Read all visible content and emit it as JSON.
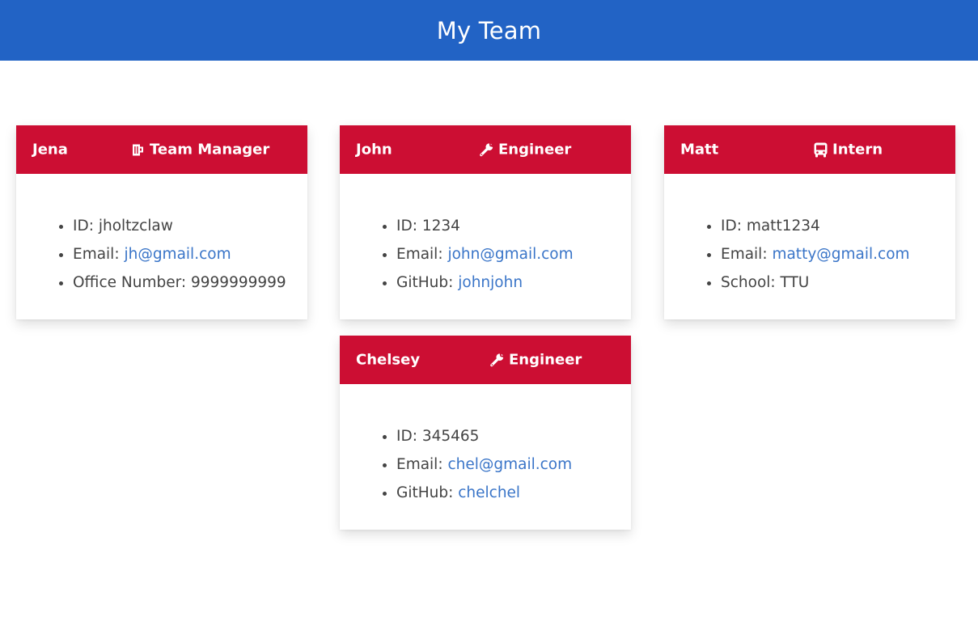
{
  "header": {
    "title": "My Team"
  },
  "members": [
    {
      "name": "Jena",
      "role": "Team Manager",
      "icon": "mug-icon",
      "id_label": "ID: ",
      "id": "jholtzclaw",
      "email_label": "Email: ",
      "email": "jh@gmail.com",
      "extra_label": "Office Number: ",
      "extra_value": "9999999999"
    },
    {
      "name": "John",
      "role": "Engineer",
      "icon": "wrench-icon",
      "id_label": "ID: ",
      "id": "1234",
      "email_label": "Email: ",
      "email": "john@gmail.com",
      "extra_label": "GitHub: ",
      "extra_value": "johnjohn"
    },
    {
      "name": "Matt",
      "role": "Intern",
      "icon": "bus-icon",
      "id_label": "ID: ",
      "id": "matt1234",
      "email_label": "Email: ",
      "email": "matty@gmail.com",
      "extra_label": "School: ",
      "extra_value": "TTU"
    },
    {
      "name": "Chelsey",
      "role": "Engineer",
      "icon": "wrench-icon",
      "id_label": "ID: ",
      "id": "345465",
      "email_label": "Email: ",
      "email": "chel@gmail.com",
      "extra_label": "GitHub: ",
      "extra_value": "chelchel"
    }
  ],
  "colors": {
    "header_bar": "#2263c5",
    "card_header": "#cc0e33",
    "link": "#3a75c8",
    "body_text": "#444444"
  }
}
